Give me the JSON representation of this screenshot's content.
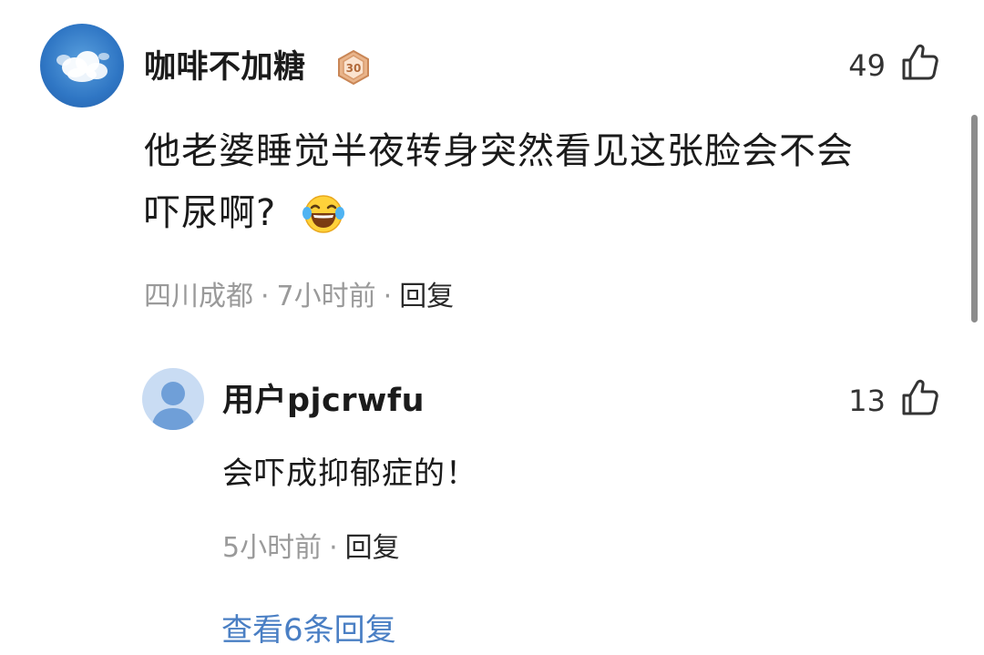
{
  "main_comment": {
    "username": "咖啡不加糖",
    "badge_level": "30",
    "like_count": "49",
    "text_line1": "他老婆睡觉半夜转身突然看见这张脸会不会",
    "text_line2": "吓尿啊?",
    "emoji": "laughing-crying-emoji",
    "location": "四川成都",
    "time": "7小时前",
    "reply_label": "回复",
    "separator": "·"
  },
  "reply_comment": {
    "username": "用户pjcrwfu",
    "like_count": "13",
    "text": "会吓成抑郁症的！",
    "time": "5小时前",
    "reply_label": "回复",
    "separator": "·"
  },
  "view_more_replies": "查看6条回复",
  "colors": {
    "link_blue": "#4a7fc4",
    "meta_gray": "#9a9a9a",
    "text_dark": "#1a1a1a"
  }
}
